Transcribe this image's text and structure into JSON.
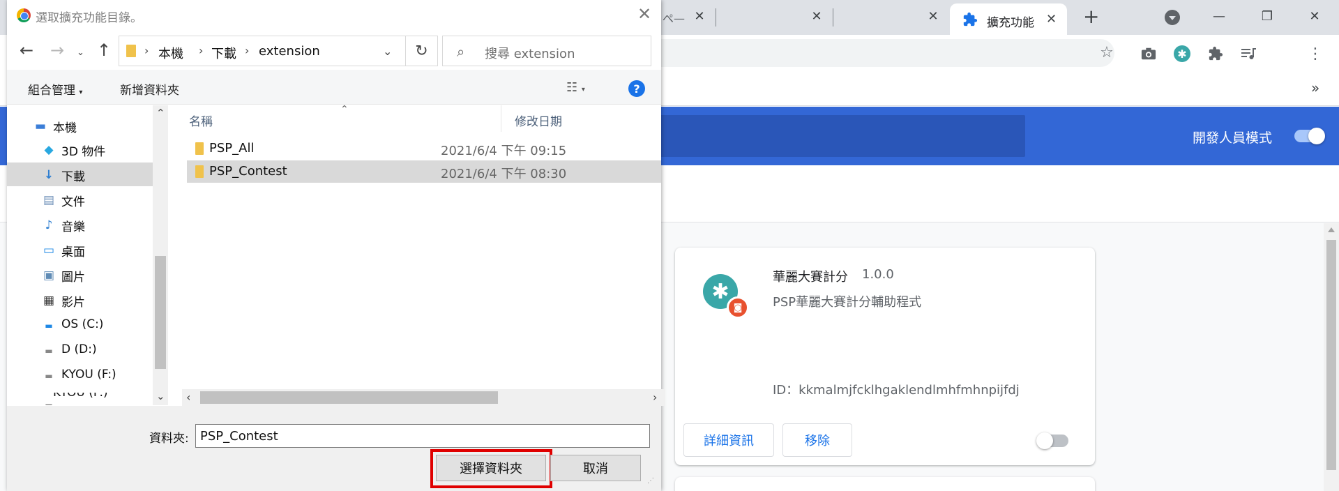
{
  "browser": {
    "tabs": [
      {
        "label": "ぺ—"
      },
      {
        "label": ""
      },
      {
        "label": "擴充功能",
        "active": true
      }
    ],
    "bookmarks_more": "»"
  },
  "extensions_page": {
    "dev_mode_label": "開發人員模式",
    "dev_mode_on": true,
    "card": {
      "name": "華麗大賽計分",
      "version": "1.0.0",
      "description": "PSP華麗大賽計分輔助程式",
      "id_line": "ID：kkmalmjfcklhgaklendlmhfmhnpijfdj",
      "details_button": "詳細資訊",
      "remove_button": "移除",
      "enabled": false
    }
  },
  "dialog": {
    "title": "選取擴充功能目錄。",
    "breadcrumb": [
      "本機",
      "下載",
      "extension"
    ],
    "search_placeholder": "搜尋 extension",
    "commands": {
      "organize": "組合管理",
      "new_folder": "新增資料夾",
      "help": "?"
    },
    "nav_items": [
      {
        "label": "本機",
        "icon": "computer-icon"
      },
      {
        "label": "3D 物件",
        "icon": "3d-objects-icon"
      },
      {
        "label": "下載",
        "icon": "download-icon",
        "selected": true
      },
      {
        "label": "文件",
        "icon": "document-icon"
      },
      {
        "label": "音樂",
        "icon": "music-icon"
      },
      {
        "label": "桌面",
        "icon": "desktop-icon"
      },
      {
        "label": "圖片",
        "icon": "pictures-icon"
      },
      {
        "label": "影片",
        "icon": "video-icon"
      },
      {
        "label": "OS (C:)",
        "icon": "drive-icon"
      },
      {
        "label": "D (D:)",
        "icon": "drive-icon"
      },
      {
        "label": "KYOU (F:)",
        "icon": "drive-icon"
      },
      {
        "label": "KYOU (F:)",
        "icon": "drive-icon"
      }
    ],
    "columns": {
      "name": "名稱",
      "modified": "修改日期"
    },
    "files": [
      {
        "name": "PSP_All",
        "modified": "2021/6/4 下午 09:15"
      },
      {
        "name": "PSP_Contest",
        "modified": "2021/6/4 下午 08:30",
        "selected": true
      }
    ],
    "folder_label": "資料夾:",
    "folder_value": "PSP_Contest",
    "select_button": "選擇資料夾",
    "cancel_button": "取消"
  }
}
